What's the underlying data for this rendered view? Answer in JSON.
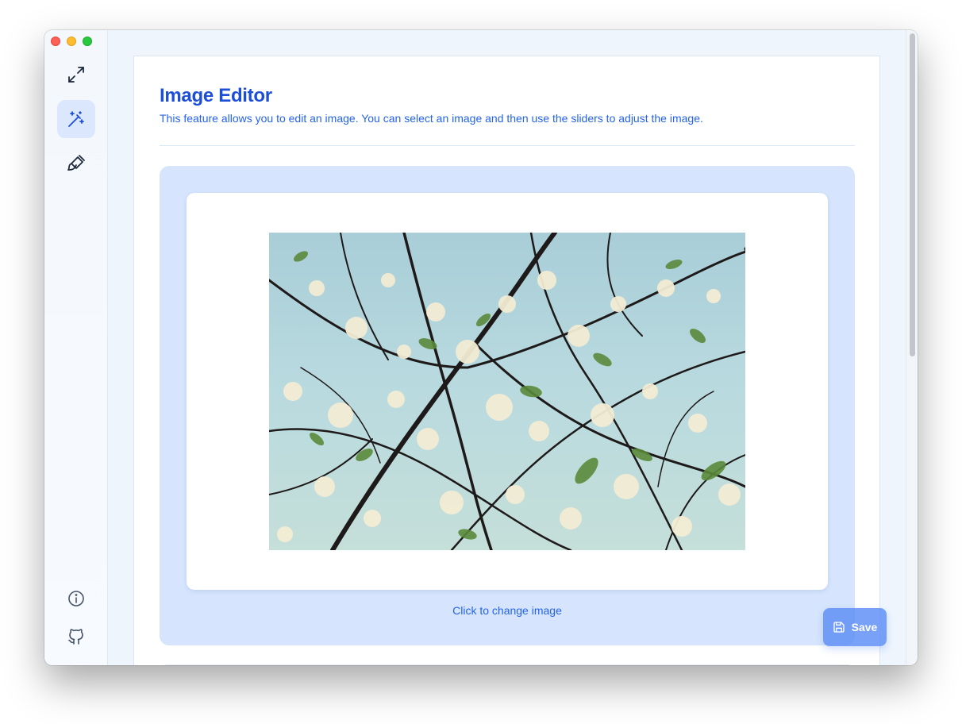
{
  "sidebar": {
    "items": [
      {
        "name": "fullscreen",
        "icon": "expand-icon",
        "active": false
      },
      {
        "name": "image-editor",
        "icon": "magic-wand-icon",
        "active": true
      },
      {
        "name": "paint",
        "icon": "paintbrush-icon",
        "active": false
      }
    ],
    "bottom": [
      {
        "name": "info",
        "icon": "info-icon"
      },
      {
        "name": "github",
        "icon": "github-icon"
      }
    ]
  },
  "page": {
    "title": "Image Editor",
    "description": "This feature allows you to edit an image. You can select an image and then use the sliders to adjust the image."
  },
  "editor": {
    "change_label": "Click to change image"
  },
  "actions": {
    "save_label": "Save",
    "save_icon": "save-icon"
  },
  "colors": {
    "accent": "#1d4ed8",
    "link": "#2563eb",
    "drop_zone": "#d6e5fd",
    "sidebar_active": "#dbe7fd"
  }
}
